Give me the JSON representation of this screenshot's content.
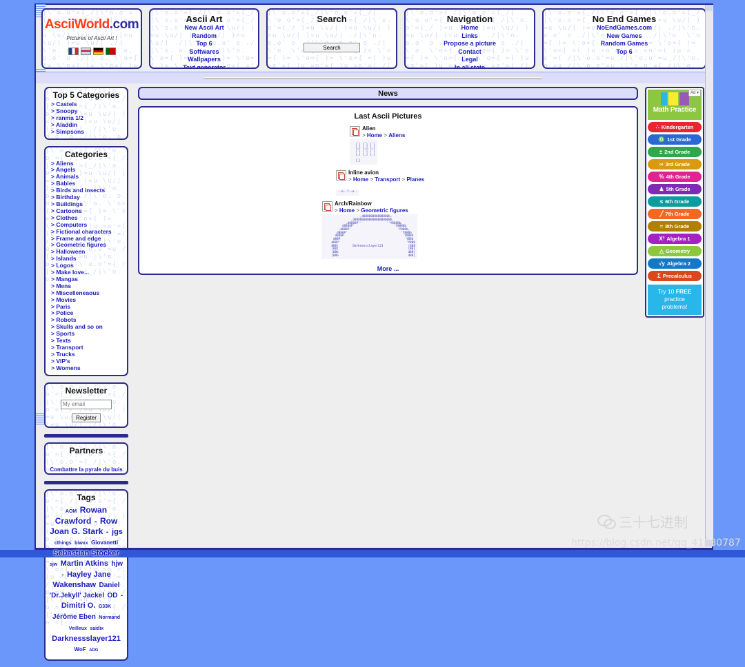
{
  "site": {
    "logo_main": "AsciiWorld",
    "logo_suffix": ".com",
    "tagline": "Pictures of Ascii Art !",
    "flags": [
      "flag-france",
      "flag-uk",
      "flag-germany",
      "flag-portugal"
    ]
  },
  "header": {
    "asciiart": {
      "title": "Ascii Art",
      "links": [
        "New Ascii Art",
        "Random",
        "Top 6",
        "Softwares",
        "Wallpapers",
        "Text generator"
      ]
    },
    "search": {
      "title": "Search",
      "button_label": "Search",
      "input_value": ""
    },
    "navigation": {
      "title": "Navigation",
      "links": [
        "Home",
        "Links",
        "Propose a picture",
        "Contact",
        "Legal",
        "In all state"
      ]
    },
    "games": {
      "title": "No End Games",
      "links": [
        "NoEndGames.com",
        "New Games",
        "Random Games",
        "Top 6"
      ]
    }
  },
  "sidebar": {
    "top5": {
      "title": "Top 5 Categories",
      "items": [
        "Castels",
        "Snoopy",
        "ranma 1/2",
        "Aladdin",
        "Simpsons"
      ]
    },
    "categories": {
      "title": "Categories",
      "items": [
        "Aliens",
        "Angels",
        "Animals",
        "Babies",
        "Birds and insects",
        "Birthday",
        "Buildings",
        "Cartoons",
        "Clothes",
        "Computers",
        "Fictional characters",
        "Frame and edge",
        "Geometric figures",
        "Halloween",
        "Islands",
        "Logos",
        "Make love...",
        "Mangas",
        "Mens",
        "Miscelleneaous",
        "Movies",
        "Paris",
        "Police",
        "Robots",
        "Skulls and so on",
        "Sports",
        "Texts",
        "Transport",
        "Trucks",
        "VIP's",
        "Womens"
      ]
    },
    "newsletter": {
      "title": "Newsletter",
      "input_placeholder": "My email",
      "button_label": "Register"
    },
    "partners": {
      "title": "Partners",
      "links": [
        "Combattre la pyrale du buis"
      ]
    },
    "tags": {
      "title": "Tags",
      "items": [
        {
          "label": "AOM",
          "size": 7
        },
        {
          "label": "Rowan Crawford",
          "size": 12
        },
        {
          "label": "-",
          "size": 11
        },
        {
          "label": "Row",
          "size": 12
        },
        {
          "label": "Joan G. Stark",
          "size": 12
        },
        {
          "label": "-",
          "size": 11
        },
        {
          "label": "jgs",
          "size": 11
        },
        {
          "label": "cthings",
          "size": 7
        },
        {
          "label": "biwxx",
          "size": 7
        },
        {
          "label": "Giovanetti",
          "size": 8
        },
        {
          "label": "Sebastian Stöcker",
          "size": 11
        },
        {
          "label": "sjw",
          "size": 7
        },
        {
          "label": "Martin Atkins",
          "size": 11
        },
        {
          "label": "hjw",
          "size": 10
        },
        {
          "label": "-",
          "size": 10
        },
        {
          "label": "Hayley Jane Wakenshaw",
          "size": 11
        },
        {
          "label": "Daniel 'Dr.Jekyll' Jackel",
          "size": 10
        },
        {
          "label": "OD",
          "size": 10
        },
        {
          "label": "-",
          "size": 10
        },
        {
          "label": "Dimitri O.",
          "size": 11
        },
        {
          "label": "G33K",
          "size": 7
        },
        {
          "label": "Jérôme Eben",
          "size": 10
        },
        {
          "label": "Normand Veilleux",
          "size": 7
        },
        {
          "label": "saidix",
          "size": 7
        },
        {
          "label": "Darknessslayer121",
          "size": 11
        },
        {
          "label": "WoF",
          "size": 8
        },
        {
          "label": "ADG",
          "size": 6
        }
      ]
    }
  },
  "main": {
    "news_title": "News",
    "content_title": "Last Ascii Pictures",
    "more_label": "More ...",
    "pictures": [
      {
        "name": "Alien",
        "breadcrumb": [
          "Home",
          "Aliens"
        ],
        "art": "   _   _   _\n  | | | | | |\n  |_| |_| |_|\n  |'| |'| |'|\n  |_| |_| |_|\n   _  \n  |_|"
      },
      {
        "name": "Inline avion",
        "breadcrumb": [
          "Home",
          "Transport",
          "Planes"
        ],
        "art": "--o--?--o--"
      },
      {
        "name": "Arch/Rainbow",
        "breadcrumb": [
          "Home",
          "Geometric figures"
        ],
        "art": "                    ,d88888888888888b,\n               ,d88800000000000000008b,\n            ,d8888P''              ''Y8888b,\n          d8888P'                      'Y8888b\n        ,d888P'                          'Y888b,\n       d888P'                              'Y888b\n      d888P                                  Y888b\n     d88P                                     Y88b\n    d88P'                                     'Y88b\n    888|        Darknessslayer121              |888\n    |88|                                       |88|\n    |88b                                       d88|\n    |88b                                       d88|"
      }
    ]
  },
  "ad": {
    "label": "Ad",
    "logo_letters": [
      "I",
      "X",
      "L"
    ],
    "wordmark": "Math Practice",
    "grades": [
      {
        "label": "Kindergarten",
        "glyph": "∴",
        "color": "#e8262b"
      },
      {
        "label": "1st Grade",
        "glyph": "♎",
        "color": "#2c68d4"
      },
      {
        "label": "2nd Grade",
        "glyph": "±",
        "color": "#2ea84a"
      },
      {
        "label": "3rd Grade",
        "glyph": "∞",
        "color": "#d99a11"
      },
      {
        "label": "4th Grade",
        "glyph": "%",
        "color": "#e0248f"
      },
      {
        "label": "5th Grade",
        "glyph": "♟",
        "color": "#7e2ab5"
      },
      {
        "label": "6th Grade",
        "glyph": "≤",
        "color": "#0d9c9c"
      },
      {
        "label": "7th Grade",
        "glyph": "╱",
        "color": "#f26722"
      },
      {
        "label": "8th Grade",
        "glyph": "≈",
        "color": "#b08000"
      },
      {
        "label": "Algebra 1",
        "glyph": "X²",
        "color": "#a621c4"
      },
      {
        "label": "Geometry",
        "glyph": "△",
        "color": "#8dc63f"
      },
      {
        "label": "Algebra 2",
        "glyph": "√y",
        "color": "#1279c4"
      },
      {
        "label": "Precalculus",
        "glyph": "Σ",
        "color": "#d9481c"
      }
    ],
    "cta_line1": "Try 10",
    "cta_bold": "FREE",
    "cta_line2": "practice",
    "cta_line3": "problems!"
  },
  "watermark": {
    "wechat_text": "三十七进制",
    "url": "https://blog.csdn.net/qq_41880787"
  },
  "colors": {
    "page_blue": "#6b97fa",
    "border_navy": "#2b2b8f",
    "link_blue": "#1b1bbb",
    "logo_orange": "#ff3c14",
    "band_lavender": "#dcdcfb"
  }
}
